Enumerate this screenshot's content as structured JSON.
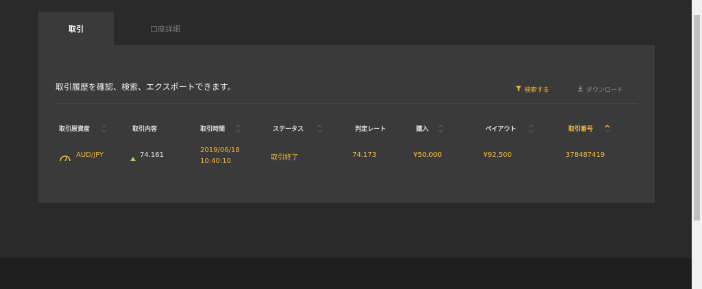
{
  "tabs": [
    {
      "label": "取引",
      "active": true
    },
    {
      "label": "口座詳細",
      "active": false
    }
  ],
  "description": "取引履歴を確認、検索、エクスポートできます。",
  "actions": {
    "search_label": "検索する",
    "download_label": "ダウンロード"
  },
  "table": {
    "headers": [
      "取引原資産",
      "取引内容",
      "取引時間",
      "ステータス",
      "判定レート",
      "購入",
      "ペイアウト",
      "取引番号"
    ],
    "sorted_column": "取引番号",
    "rows": [
      {
        "asset": "AUD/JPY",
        "direction": "high",
        "rate": "74.161",
        "date": "2019/06/18",
        "time": "10:40:10",
        "status": "取引終了",
        "judgement_rate": "74.173",
        "purchase": "¥50,000",
        "payout": "¥92,500",
        "trade_id": "378487419"
      }
    ]
  },
  "colors": {
    "accent": "#f0b839",
    "panel": "#3a3a3a",
    "background": "#2a2a2a",
    "up": "#9ad84a"
  }
}
